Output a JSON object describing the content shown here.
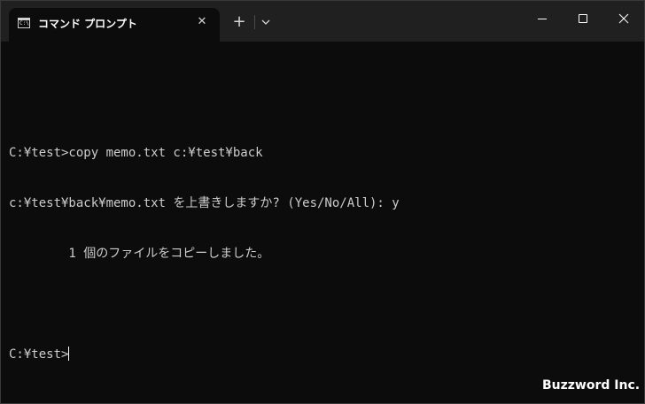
{
  "tab": {
    "icon_text": "C:\\",
    "title": "コマンド プロンプト",
    "close_glyph": "✕"
  },
  "toolbar": {
    "new_tab_glyph": "+"
  },
  "terminal": {
    "lines": [
      "",
      "C:¥test>copy memo.txt c:¥test¥back",
      "c:¥test¥back¥memo.txt を上書きしますか? (Yes/No/All): y",
      "        1 個のファイルをコピーしました。",
      "",
      "C:¥test>"
    ]
  },
  "watermark": "Buzzword Inc."
}
